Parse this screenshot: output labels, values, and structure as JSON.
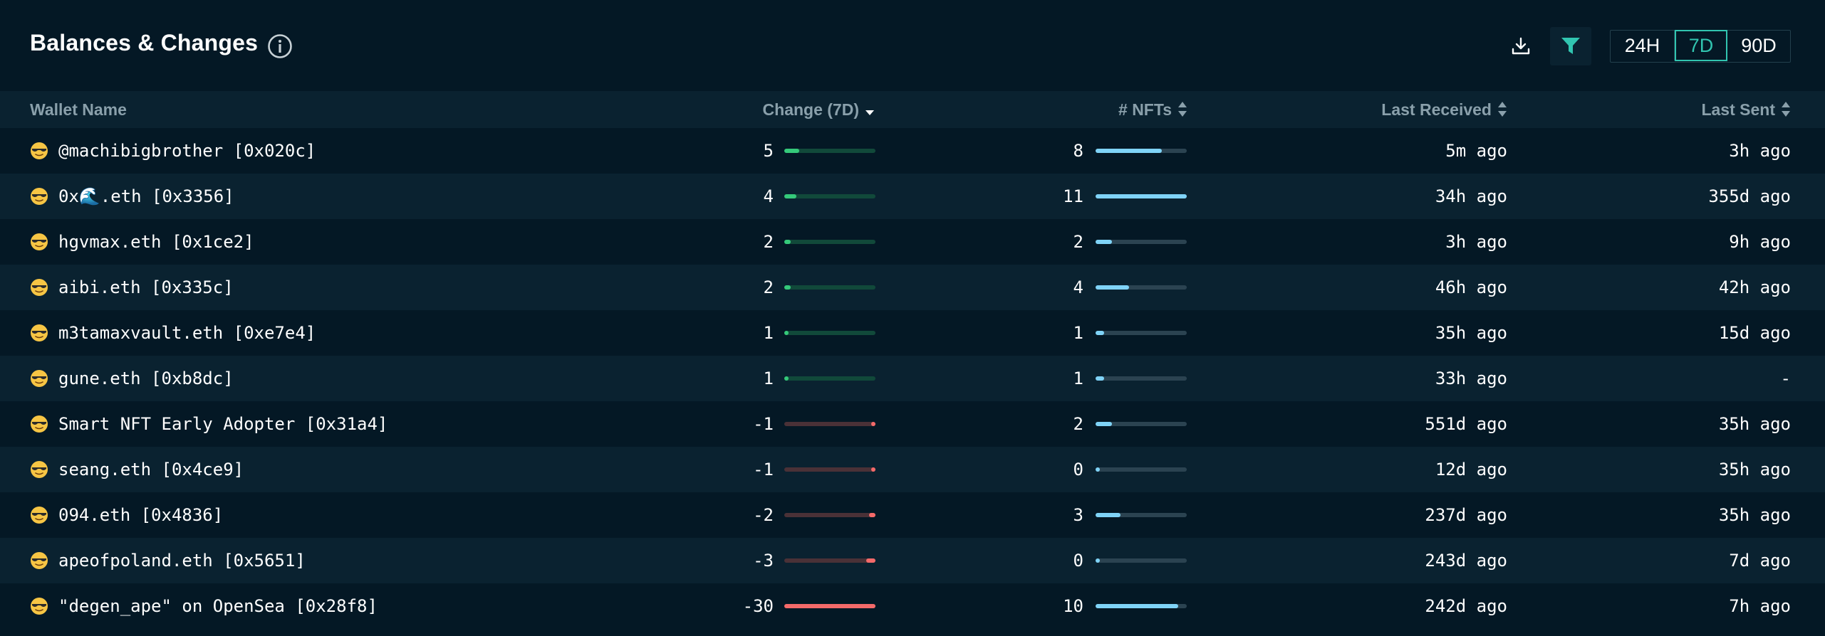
{
  "header": {
    "title": "Balances & Changes",
    "range_buttons": [
      "24H",
      "7D",
      "90D"
    ],
    "active_range": "7D"
  },
  "columns": {
    "wallet": "Wallet Name",
    "change": "Change (7D)",
    "nfts": "# NFTs",
    "last_received": "Last Received",
    "last_sent": "Last Sent"
  },
  "colors": {
    "positive": "#35c97a",
    "positive_track": "#11493a",
    "negative": "#f46a6a",
    "negative_track": "#4a3137",
    "nfts": "#7fd3f7",
    "nfts_track": "#2b4351",
    "accent": "#31c5b0"
  },
  "rows": [
    {
      "wallet": "@machibigbrother [0x020c]",
      "change": "5",
      "change_value": 5,
      "nfts": "8",
      "nfts_value": 8,
      "last_received": "5m ago",
      "last_sent": "3h ago"
    },
    {
      "wallet": "0x🌊.eth [0x3356]",
      "change": "4",
      "change_value": 4,
      "nfts": "11",
      "nfts_value": 11,
      "last_received": "34h ago",
      "last_sent": "355d ago"
    },
    {
      "wallet": "hgvmax.eth [0x1ce2]",
      "change": "2",
      "change_value": 2,
      "nfts": "2",
      "nfts_value": 2,
      "last_received": "3h ago",
      "last_sent": "9h ago"
    },
    {
      "wallet": "aibi.eth [0x335c]",
      "change": "2",
      "change_value": 2,
      "nfts": "4",
      "nfts_value": 4,
      "last_received": "46h ago",
      "last_sent": "42h ago"
    },
    {
      "wallet": "m3tamaxvault.eth [0xe7e4]",
      "change": "1",
      "change_value": 1,
      "nfts": "1",
      "nfts_value": 1,
      "last_received": "35h ago",
      "last_sent": "15d ago"
    },
    {
      "wallet": "gune.eth [0xb8dc]",
      "change": "1",
      "change_value": 1,
      "nfts": "1",
      "nfts_value": 1,
      "last_received": "33h ago",
      "last_sent": "-"
    },
    {
      "wallet": "Smart NFT Early Adopter [0x31a4]",
      "change": "-1",
      "change_value": -1,
      "nfts": "2",
      "nfts_value": 2,
      "last_received": "551d ago",
      "last_sent": "35h ago"
    },
    {
      "wallet": "seang.eth [0x4ce9]",
      "change": "-1",
      "change_value": -1,
      "nfts": "0",
      "nfts_value": 0,
      "last_received": "12d ago",
      "last_sent": "35h ago"
    },
    {
      "wallet": "094.eth [0x4836]",
      "change": "-2",
      "change_value": -2,
      "nfts": "3",
      "nfts_value": 3,
      "last_received": "237d ago",
      "last_sent": "35h ago"
    },
    {
      "wallet": "apeofpoland.eth [0x5651]",
      "change": "-3",
      "change_value": -3,
      "nfts": "0",
      "nfts_value": 0,
      "last_received": "243d ago",
      "last_sent": "7d ago"
    },
    {
      "wallet": "\"degen_ape\" on OpenSea [0x28f8]",
      "change": "-30",
      "change_value": -30,
      "nfts": "10",
      "nfts_value": 10,
      "last_received": "242d ago",
      "last_sent": "7h ago"
    }
  ]
}
